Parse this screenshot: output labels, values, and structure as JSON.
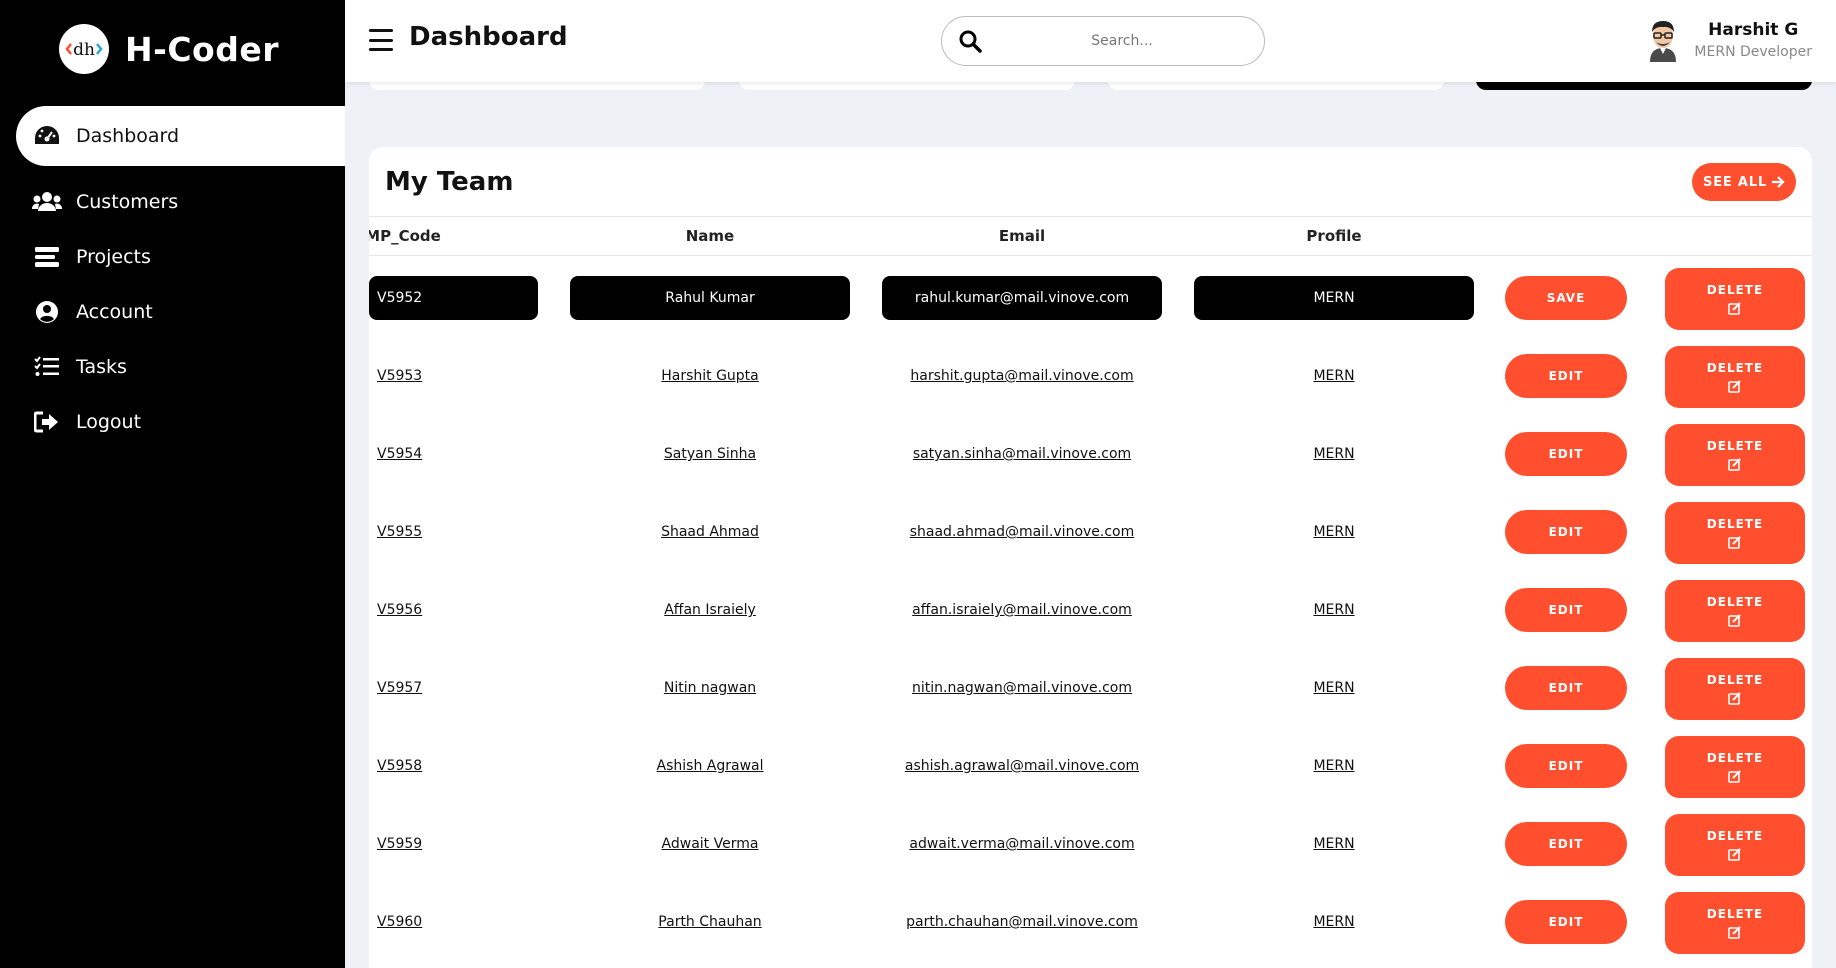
{
  "brand": {
    "title": "H-Coder"
  },
  "sidebar": {
    "items": [
      {
        "label": "Dashboard",
        "icon": "gauge-icon",
        "active": true
      },
      {
        "label": "Customers",
        "icon": "users-icon"
      },
      {
        "label": "Projects",
        "icon": "list-icon"
      },
      {
        "label": "Account",
        "icon": "user-circle-icon"
      },
      {
        "label": "Tasks",
        "icon": "tasks-icon"
      },
      {
        "label": "Logout",
        "icon": "logout-icon"
      }
    ]
  },
  "header": {
    "title": "Dashboard",
    "search_placeholder": "Search...",
    "user_name": "Harshit G",
    "user_role": "MERN Developer"
  },
  "team": {
    "title": "My Team",
    "see_all_label": "SEE ALL",
    "columns": [
      "MP_Code",
      "Name",
      "Email",
      "Profile"
    ],
    "save_label": "SAVE",
    "edit_label": "EDIT",
    "delete_label": "DELETE",
    "rows": [
      {
        "code": "V5952",
        "name": "Rahul Kumar",
        "email": "rahul.kumar@mail.vinove.com",
        "profile": "MERN",
        "editing": true
      },
      {
        "code": "V5953",
        "name": "Harshit Gupta",
        "email": "harshit.gupta@mail.vinove.com",
        "profile": "MERN"
      },
      {
        "code": "V5954",
        "name": "Satyan Sinha",
        "email": "satyan.sinha@mail.vinove.com",
        "profile": "MERN"
      },
      {
        "code": "V5955",
        "name": "Shaad Ahmad",
        "email": "shaad.ahmad@mail.vinove.com",
        "profile": "MERN"
      },
      {
        "code": "V5956",
        "name": "Affan Israiely",
        "email": "affan.israiely@mail.vinove.com",
        "profile": "MERN"
      },
      {
        "code": "V5957",
        "name": "Nitin nagwan",
        "email": "nitin.nagwan@mail.vinove.com",
        "profile": "MERN"
      },
      {
        "code": "V5958",
        "name": "Ashish Agrawal",
        "email": "ashish.agrawal@mail.vinove.com",
        "profile": "MERN"
      },
      {
        "code": "V5959",
        "name": "Adwait Verma",
        "email": "adwait.verma@mail.vinove.com",
        "profile": "MERN"
      },
      {
        "code": "V5960",
        "name": "Parth Chauhan",
        "email": "parth.chauhan@mail.vinove.com",
        "profile": "MERN"
      }
    ]
  },
  "colors": {
    "accent": "#ff4f2e",
    "sidebar_bg": "#000000",
    "page_bg": "#eef2f7"
  }
}
